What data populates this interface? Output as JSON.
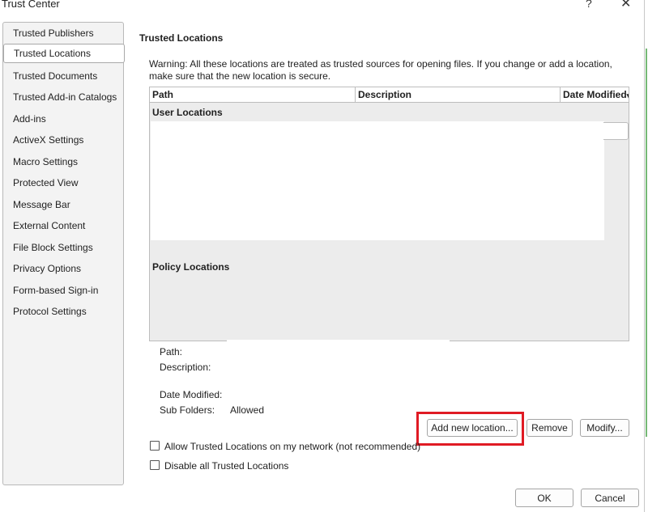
{
  "window": {
    "title": "Trust Center",
    "help_glyph": "?",
    "close_glyph": "✕"
  },
  "sidebar": {
    "items": [
      {
        "label": "Trusted Publishers"
      },
      {
        "label": "Trusted Locations"
      },
      {
        "label": "Trusted Documents"
      },
      {
        "label": "Trusted Add-in Catalogs"
      },
      {
        "label": "Add-ins"
      },
      {
        "label": "ActiveX Settings"
      },
      {
        "label": "Macro Settings"
      },
      {
        "label": "Protected View"
      },
      {
        "label": "Message Bar"
      },
      {
        "label": "External Content"
      },
      {
        "label": "File Block Settings"
      },
      {
        "label": "Privacy Options"
      },
      {
        "label": "Form-based Sign-in"
      },
      {
        "label": "Protocol Settings"
      }
    ],
    "active": "Trusted Locations"
  },
  "main": {
    "section_title": "Trusted Locations",
    "warning": "Warning: All these locations are treated as trusted sources for opening files.  If you change or add a location, make sure that the new location is secure.",
    "table": {
      "columns": [
        "Path",
        "Description",
        "Date Modified"
      ],
      "sort_glyph": "▾",
      "user_group": "User Locations",
      "policy_group": "Policy Locations"
    },
    "details": {
      "path_label": "Path:",
      "description_label": "Description:",
      "date_modified_label": "Date Modified:",
      "sub_folders_label": "Sub Folders:",
      "sub_folders_value": "Allowed"
    },
    "buttons": {
      "add_new": "Add new location...",
      "remove": "Remove",
      "modify": "Modify..."
    },
    "checkboxes": {
      "allow_network": {
        "label": "Allow Trusted Locations on my network (not recommended)",
        "checked": false
      },
      "disable_all": {
        "label": "Disable all Trusted Locations",
        "checked": false
      }
    }
  },
  "footer": {
    "ok": "OK",
    "cancel": "Cancel"
  },
  "colors": {
    "highlight": "#e01b24",
    "sidebar_bg": "#f3f3f3",
    "table_bg": "#ececec"
  }
}
